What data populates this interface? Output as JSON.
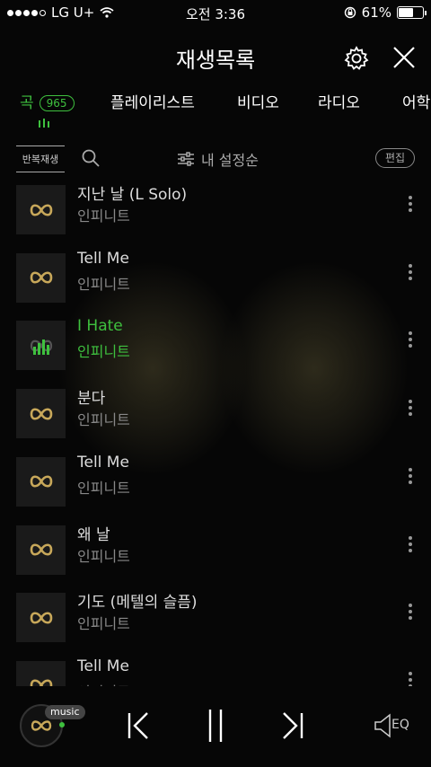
{
  "status": {
    "carrier": "LG U+",
    "time": "오전 3:36",
    "battery": "61%",
    "battery_level": 0.61
  },
  "header": {
    "title": "재생목록"
  },
  "tabs": [
    {
      "label": "곡",
      "badge": "965"
    },
    {
      "label": "플레이리스트"
    },
    {
      "label": "비디오"
    },
    {
      "label": "라디오"
    },
    {
      "label": "어학"
    }
  ],
  "toolbar": {
    "repeat": "반복재생",
    "sort": "내 설정순",
    "edit": "편집"
  },
  "songs": [
    {
      "title": "지난 날 (L Solo)",
      "artist": "인피니트"
    },
    {
      "title": "Tell Me",
      "artist": "인피니트"
    },
    {
      "title": "I Hate",
      "artist": "인피니트"
    },
    {
      "title": "분다",
      "artist": "인피니트"
    },
    {
      "title": "Tell Me",
      "artist": "인피니트"
    },
    {
      "title": "왜 날",
      "artist": "인피니트"
    },
    {
      "title": "기도 (메텔의 슬픔)",
      "artist": "인피니트"
    },
    {
      "title": "Tell Me",
      "artist": "인피니트"
    }
  ],
  "player": {
    "badge": "music",
    "eq": "EQ"
  },
  "colors": {
    "accent": "#3ec03e",
    "gold": "#c8a85a"
  }
}
